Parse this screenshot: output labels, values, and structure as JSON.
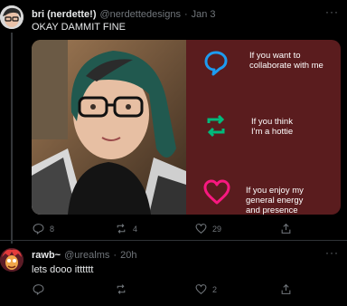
{
  "tweet": {
    "display_name": "bri (nerdette!)",
    "handle": "@nerdettedesigns",
    "separator": "·",
    "date": "Jan 3",
    "text": "OKAY DAMMIT FINE",
    "more_label": "···",
    "card": {
      "items": [
        {
          "icon": "reply-bubble-icon",
          "color": "#1d9bf0",
          "text": "If you want to\ncollaborate with me"
        },
        {
          "icon": "retweet-icon",
          "color": "#00ba7c",
          "text": "If you think\nI'm a hottie"
        },
        {
          "icon": "heart-icon",
          "color": "#f91880",
          "text": "If you enjoy my\ngeneral energy\nand presence"
        }
      ]
    },
    "actions": {
      "reply_count": "8",
      "retweet_count": "4",
      "like_count": "29",
      "share_label": ""
    }
  },
  "reply": {
    "display_name": "rawb~",
    "handle": "@urealms",
    "separator": "·",
    "date": "20h",
    "text": "lets dooo itttttt",
    "more_label": "···",
    "actions": {
      "reply_count": "",
      "retweet_count": "",
      "like_count": "2",
      "share_label": ""
    }
  },
  "colors": {
    "background": "#000000",
    "card_bg": "#5a1c1e",
    "muted": "#71767b",
    "text": "#e7e9ea"
  }
}
